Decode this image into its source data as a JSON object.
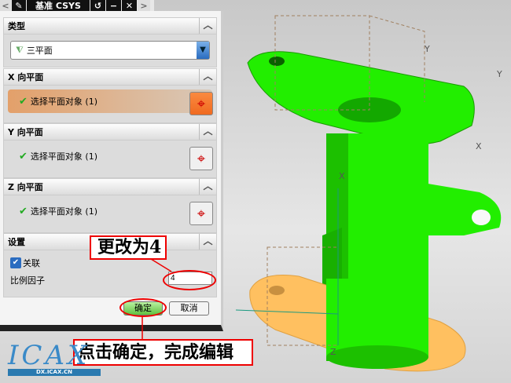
{
  "titlebar": {
    "title": "基准 CSYS"
  },
  "type_section": {
    "label": "类型",
    "selected": "三平面"
  },
  "x_plane": {
    "label": "X 向平面",
    "select": "选择平面对象 (1)"
  },
  "y_plane": {
    "label": "Y 向平面",
    "select": "选择平面对象 (1)"
  },
  "z_plane": {
    "label": "Z 向平面",
    "select": "选择平面对象 (1)"
  },
  "settings": {
    "label": "设置",
    "associative": "关联",
    "scale_label": "比例因子",
    "scale_value": "4"
  },
  "buttons": {
    "ok": "确定",
    "cancel": "取消"
  },
  "annotations": {
    "change": "更改为4",
    "click": "点击确定，完成编辑"
  },
  "axes": {
    "x": "X",
    "y": "Y",
    "z": "Z"
  },
  "watermark": {
    "logo": "ICAX",
    "url": "DX.ICAX.CN"
  },
  "colors": {
    "part": "#22ee00",
    "face": "#ffc060",
    "accent": "#e00000"
  }
}
